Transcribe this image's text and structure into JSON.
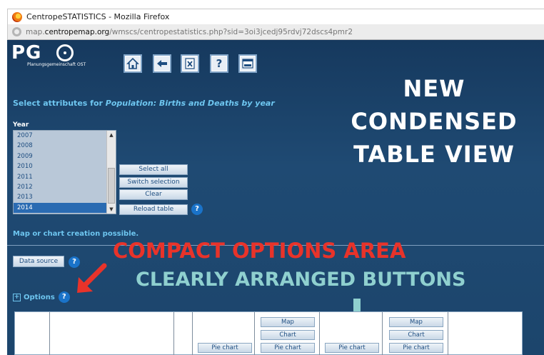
{
  "browser": {
    "window_title": "CentropeSTATISTICS - Mozilla Firefox",
    "url_prefix": "map.",
    "url_domain": "centropemap.org",
    "url_path": "/wmscs/centropestatistics.php?sid=3oi3jcedj95rdvj72dscs4pmr2"
  },
  "logo": {
    "text": "PG",
    "subtitle": "Planungsgemeinschaft OST"
  },
  "toolbar": {
    "help_label": "?",
    "icons": [
      "home-icon",
      "back-arrow-icon",
      "excel-export-icon",
      "help-icon",
      "close-window-icon"
    ]
  },
  "attributes": {
    "prefix": "Select attributes for ",
    "dataset": "Population: Births and Deaths by year"
  },
  "year": {
    "label": "Year",
    "items": [
      "2007",
      "2008",
      "2009",
      "2010",
      "2011",
      "2012",
      "2013",
      "2014"
    ],
    "selected": "2014"
  },
  "buttons": {
    "select_all": "Select all",
    "switch_selection": "Switch selection",
    "clear": "Clear",
    "reload_table": "Reload table",
    "data_source": "Data source"
  },
  "help_mark": "?",
  "status_text": "Map or chart creation possible.",
  "options_label": "Options",
  "plus_mark": "+",
  "annotations": {
    "headline_line1": "NEW",
    "headline_line2": "CONDENSED",
    "headline_line3": "TABLE VIEW",
    "red_text": "COMPACT OPTIONS AREA",
    "teal_text": "CLEARLY ARRANGED BUTTONS"
  },
  "table_buttons": {
    "pie_chart": "Pie chart",
    "map": "Map",
    "chart": "Chart"
  },
  "colors": {
    "page_bg": "#1f4a73",
    "accent_text": "#6ec6f0",
    "red_annotation": "#e8332a",
    "teal_annotation": "#8fd0cf"
  }
}
